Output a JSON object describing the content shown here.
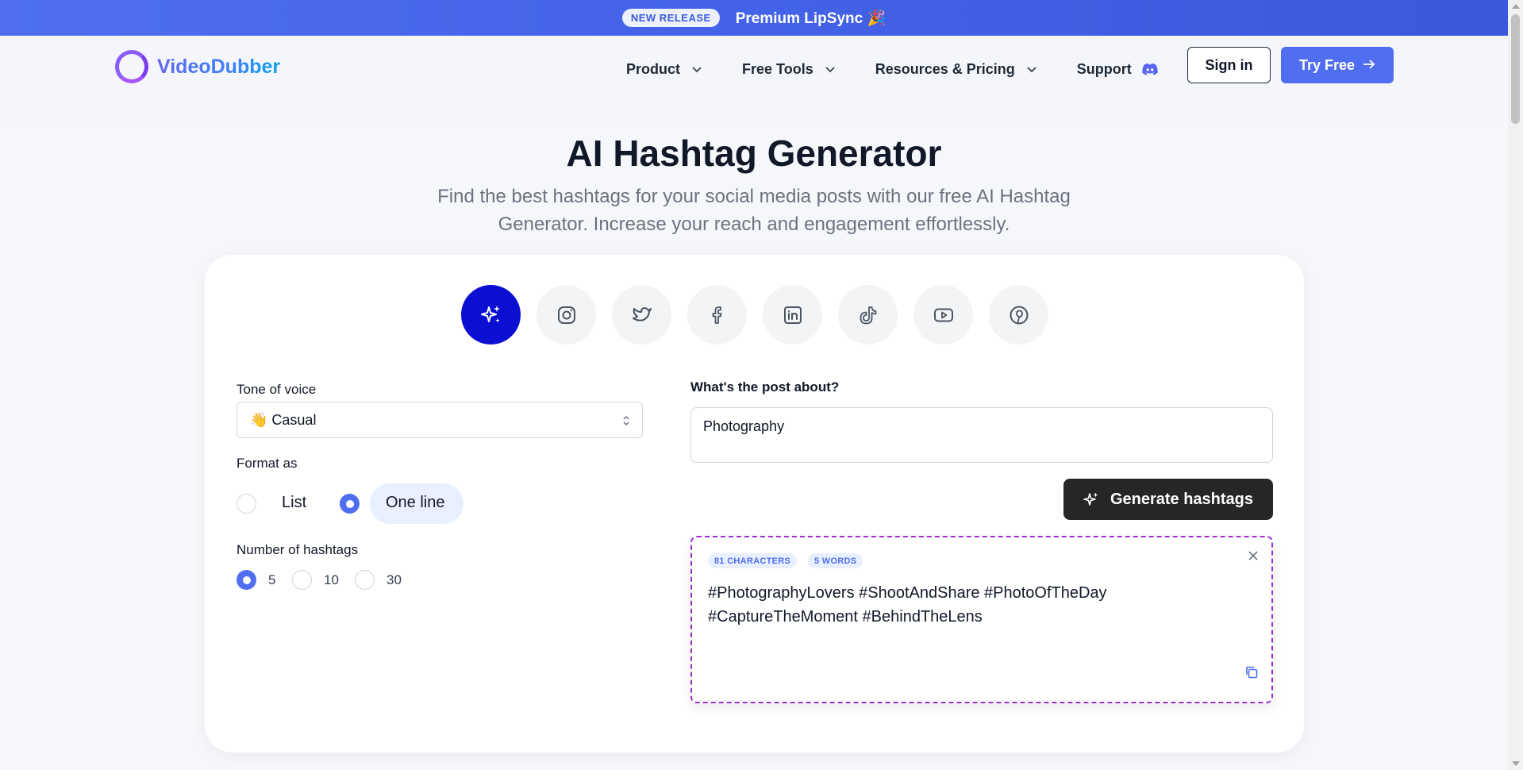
{
  "promo": {
    "badge": "NEW RELEASE",
    "text": "Premium LipSync 🎉"
  },
  "header": {
    "logo": "VideoDubber",
    "nav": [
      {
        "label": "Product",
        "icon": "chevron-down-icon"
      },
      {
        "label": "Free Tools",
        "icon": "chevron-down-icon"
      },
      {
        "label": "Resources & Pricing",
        "icon": "chevron-down-icon"
      },
      {
        "label": "Support",
        "icon": "discord-icon"
      }
    ],
    "signin": "Sign in",
    "tryfree": "Try Free"
  },
  "hero": {
    "title": "AI Hashtag Generator",
    "subtitle": "Find the best hashtags for your social media posts with our free AI Hashtag Generator. Increase your reach and engagement effortlessly."
  },
  "platforms": [
    {
      "name": "ai-sparkle-icon",
      "active": true
    },
    {
      "name": "instagram-icon",
      "active": false
    },
    {
      "name": "twitter-icon",
      "active": false
    },
    {
      "name": "facebook-icon",
      "active": false
    },
    {
      "name": "linkedin-icon",
      "active": false
    },
    {
      "name": "tiktok-icon",
      "active": false
    },
    {
      "name": "youtube-icon",
      "active": false
    },
    {
      "name": "pinterest-icon",
      "active": false
    }
  ],
  "form": {
    "tone_label": "Tone of voice",
    "tone_value": "👋 Casual",
    "format_label": "Format as",
    "format_options": [
      "List",
      "One line"
    ],
    "format_selected": "One line",
    "count_label": "Number of hashtags",
    "count_options": [
      "5",
      "10",
      "30"
    ],
    "count_selected": "5",
    "post_label": "What's the post about?",
    "post_value": "Photography",
    "generate_label": "Generate hashtags"
  },
  "result": {
    "characters": "81 CHARACTERS",
    "words": "5 WORDS",
    "hashtags": "#PhotographyLovers #ShootAndShare #PhotoOfTheDay #CaptureTheMoment #BehindTheLens"
  },
  "colors": {
    "accent": "#4f6ef0",
    "active_platform": "#0b0fd1",
    "result_border": "#9b2fd0",
    "button_dark": "#262626"
  }
}
